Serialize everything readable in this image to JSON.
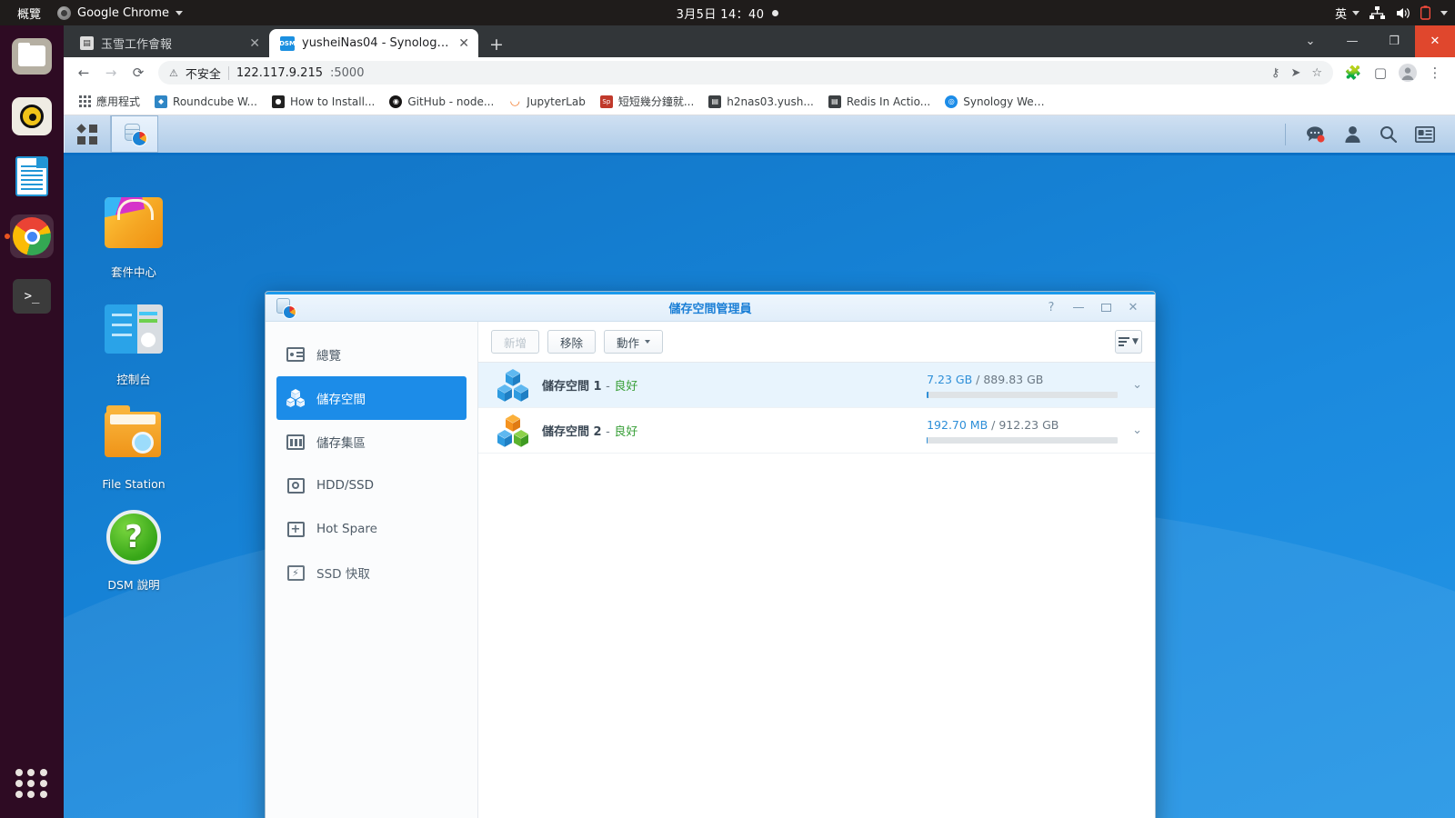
{
  "ubuntu": {
    "topbar": {
      "activities_label": "概覽",
      "app_menu_label": "Google Chrome",
      "clock": "3月5日  14：40",
      "input_method": "英",
      "icons": [
        "network-icon",
        "volume-icon",
        "battery-icon"
      ]
    },
    "dock": {
      "items": [
        {
          "name": "files-icon",
          "label": "Files"
        },
        {
          "name": "rhythmbox-icon",
          "label": "Rhythmbox"
        },
        {
          "name": "libreoffice-icon",
          "label": "LibreOffice"
        },
        {
          "name": "chrome-icon",
          "label": "Google Chrome",
          "active": true
        },
        {
          "name": "terminal-icon",
          "label": "Terminal"
        }
      ],
      "show_apps_label": "Show Applications"
    }
  },
  "chrome": {
    "tabs": [
      {
        "title": "玉雪工作會報",
        "favicon": "book-icon",
        "active": false
      },
      {
        "title": "yusheiNas04 - Synology D",
        "favicon": "dsm-icon",
        "active": true
      }
    ],
    "new_tab_label": "+",
    "close_label": "✕",
    "window_controls": {
      "list": "⌄",
      "minimize": "—",
      "maximize": "❐",
      "close": "✕"
    },
    "toolbar": {
      "back": "←",
      "forward": "→",
      "reload": "⟳",
      "security_label": "不安全",
      "url_host": "122.117.9.215",
      "url_port": ":5000",
      "actions": [
        "key-icon",
        "send-icon",
        "star-icon"
      ],
      "right_icons": [
        "extensions-icon",
        "sidepanel-icon",
        "profile-icon",
        "menu-icon"
      ]
    },
    "bookmarks": [
      {
        "label": "應用程式",
        "icon": "apps-grid-icon",
        "color": "#5f6368"
      },
      {
        "label": "Roundcube W...",
        "icon": "roundcube-icon",
        "color": "#2f86c5"
      },
      {
        "label": "How to Install...",
        "icon": "globe-icon",
        "color": "#222222"
      },
      {
        "label": "GitHub - node...",
        "icon": "github-icon",
        "color": "#171515"
      },
      {
        "label": "JupyterLab",
        "icon": "jupyter-icon",
        "color": "#f37726"
      },
      {
        "label": "短短幾分鐘就...",
        "icon": "sp-icon",
        "color": "#c0392b"
      },
      {
        "label": "h2nas03.yush...",
        "icon": "book-icon",
        "color": "#3c4043"
      },
      {
        "label": "Redis In Actio...",
        "icon": "book-icon",
        "color": "#3c4043"
      },
      {
        "label": "Synology Web...",
        "icon": "synology-icon",
        "color": "#1c8ce8"
      }
    ]
  },
  "dsm": {
    "taskbar": {
      "main_menu_label": "主選單",
      "open_app_label": "儲存空間管理員",
      "right_icons": [
        "notifications-icon",
        "user-icon",
        "search-icon",
        "widgets-icon"
      ]
    },
    "desktop_icons": [
      {
        "label": "套件中心",
        "icon": "package-center-icon"
      },
      {
        "label": "控制台",
        "icon": "control-panel-icon"
      },
      {
        "label": "File Station",
        "icon": "file-station-icon"
      },
      {
        "label": "DSM 說明",
        "icon": "dsm-help-icon"
      }
    ],
    "window": {
      "title": "儲存空間管理員",
      "app_icon": "storage-manager-icon",
      "controls": {
        "help": "?",
        "minimize": "minimize-icon",
        "maximize": "maximize-icon",
        "close": "✕"
      },
      "sidebar": [
        {
          "label": "總覽",
          "icon": "overview-icon",
          "active": false
        },
        {
          "label": "儲存空間",
          "icon": "volume-icon",
          "active": true
        },
        {
          "label": "儲存集區",
          "icon": "storage-pool-icon",
          "active": false
        },
        {
          "label": "HDD/SSD",
          "icon": "hdd-ssd-icon",
          "active": false
        },
        {
          "label": "Hot Spare",
          "icon": "hot-spare-icon",
          "active": false
        },
        {
          "label": "SSD 快取",
          "icon": "ssd-cache-icon",
          "active": false
        }
      ],
      "toolbar": {
        "create_label": "新增",
        "create_disabled": true,
        "remove_label": "移除",
        "action_label": "動作",
        "sort_label": "sort-icon"
      },
      "volumes": [
        {
          "name": "儲存空間",
          "number": "1",
          "dash": "-",
          "status": "良好",
          "used": "7.23 GB",
          "separator": "/",
          "total": "889.83 GB",
          "used_percent": 1,
          "selected": true,
          "icon": "volume-cubes-blue-icon",
          "expand": "chevron-down-icon"
        },
        {
          "name": "儲存空間",
          "number": "2",
          "dash": "-",
          "status": "良好",
          "used": "192.70 MB",
          "separator": "/",
          "total": "912.23 GB",
          "used_percent": 0.1,
          "selected": false,
          "icon": "volume-cubes-color-icon",
          "expand": "chevron-down-icon"
        }
      ]
    }
  },
  "colors": {
    "dsm_accent": "#1c8ce8",
    "status_good": "#3aa03a",
    "used_blue": "#2e8fd8",
    "chrome_close": "#e0472d"
  }
}
